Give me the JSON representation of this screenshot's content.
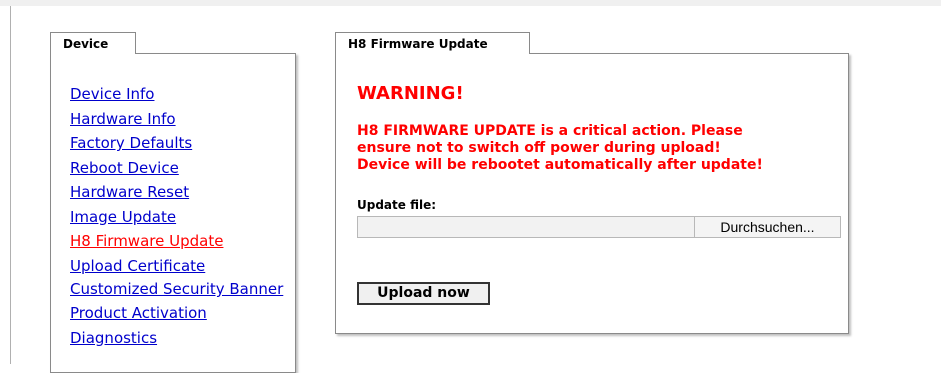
{
  "device_panel": {
    "tab_label": "Device",
    "nav_items": [
      {
        "label": "Device Info"
      },
      {
        "label": "Hardware Info"
      },
      {
        "label": "Factory Defaults"
      },
      {
        "label": "Reboot Device"
      },
      {
        "label": "Hardware Reset"
      },
      {
        "label": "Image Update"
      },
      {
        "label": "H8 Firmware Update",
        "active": true
      },
      {
        "label": "Upload Certificate"
      },
      {
        "label": "Customized Security Banner"
      },
      {
        "label": "Product Activation"
      },
      {
        "label": "Diagnostics"
      }
    ]
  },
  "firmware_panel": {
    "tab_label": "H8 Firmware Update",
    "warning_title": "WARNING!",
    "warning_line1": "H8 FIRMWARE UPDATE is a critical action. Please",
    "warning_line2": "ensure not to switch off power during upload!",
    "warning_line3": "Device will be rebootet automatically after update!",
    "file_label": "Update file:",
    "file_value": "",
    "browse_label": "Durchsuchen...",
    "upload_label": "Upload now"
  },
  "colors": {
    "link": "#0000cc",
    "active_link": "#ff0000",
    "warning": "#ff0000"
  }
}
